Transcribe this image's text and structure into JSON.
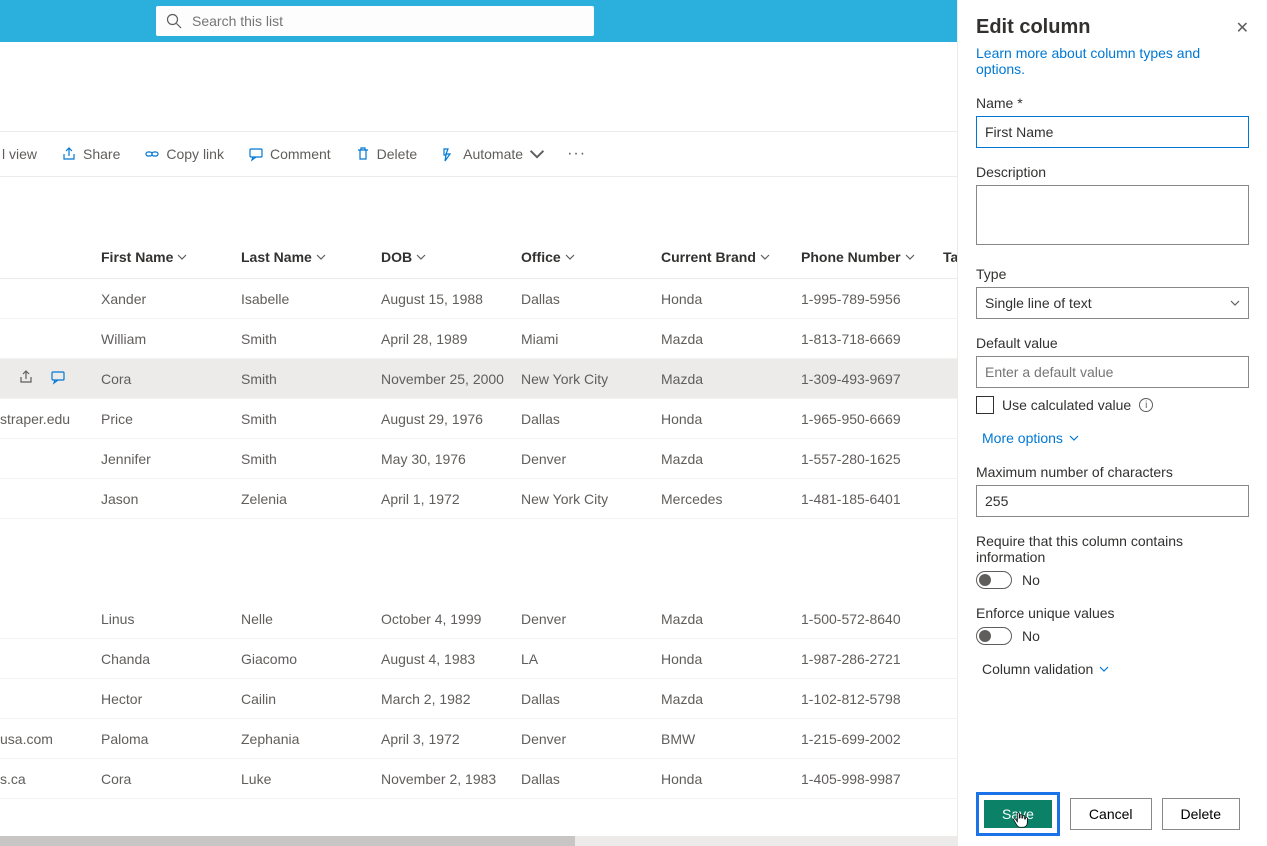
{
  "search": {
    "placeholder": "Search this list"
  },
  "commands": {
    "gridview": "l view",
    "share": "Share",
    "copylink": "Copy link",
    "comment": "Comment",
    "delete": "Delete",
    "automate": "Automate"
  },
  "columns": {
    "firstname": "First Name",
    "lastname": "Last Name",
    "dob": "DOB",
    "office": "Office",
    "brand": "Current Brand",
    "phone": "Phone Number",
    "extra": "Ta"
  },
  "rows": [
    {
      "email": "",
      "first": "Xander",
      "last": "Isabelle",
      "dob": "August 15, 1988",
      "office": "Dallas",
      "brand": "Honda",
      "phone": "1-995-789-5956"
    },
    {
      "email": "",
      "first": "William",
      "last": "Smith",
      "dob": "April 28, 1989",
      "office": "Miami",
      "brand": "Mazda",
      "phone": "1-813-718-6669"
    },
    {
      "email": "",
      "first": "Cora",
      "last": "Smith",
      "dob": "November 25, 2000",
      "office": "New York City",
      "brand": "Mazda",
      "phone": "1-309-493-9697",
      "selected": true,
      "icons": true
    },
    {
      "email": "straper.edu",
      "first": "Price",
      "last": "Smith",
      "dob": "August 29, 1976",
      "office": "Dallas",
      "brand": "Honda",
      "phone": "1-965-950-6669"
    },
    {
      "email": "",
      "first": "Jennifer",
      "last": "Smith",
      "dob": "May 30, 1976",
      "office": "Denver",
      "brand": "Mazda",
      "phone": "1-557-280-1625"
    },
    {
      "email": "",
      "first": "Jason",
      "last": "Zelenia",
      "dob": "April 1, 1972",
      "office": "New York City",
      "brand": "Mercedes",
      "phone": "1-481-185-6401"
    }
  ],
  "rows2": [
    {
      "email": "",
      "first": "Linus",
      "last": "Nelle",
      "dob": "October 4, 1999",
      "office": "Denver",
      "brand": "Mazda",
      "phone": "1-500-572-8640"
    },
    {
      "email": "",
      "first": "Chanda",
      "last": "Giacomo",
      "dob": "August 4, 1983",
      "office": "LA",
      "brand": "Honda",
      "phone": "1-987-286-2721"
    },
    {
      "email": "",
      "first": "Hector",
      "last": "Cailin",
      "dob": "March 2, 1982",
      "office": "Dallas",
      "brand": "Mazda",
      "phone": "1-102-812-5798"
    },
    {
      "email": "usa.com",
      "first": "Paloma",
      "last": "Zephania",
      "dob": "April 3, 1972",
      "office": "Denver",
      "brand": "BMW",
      "phone": "1-215-699-2002"
    },
    {
      "email": "s.ca",
      "first": "Cora",
      "last": "Luke",
      "dob": "November 2, 1983",
      "office": "Dallas",
      "brand": "Honda",
      "phone": "1-405-998-9987"
    }
  ],
  "panel": {
    "title": "Edit column",
    "learn": "Learn more about column types and options.",
    "name_label": "Name *",
    "name_value": "First Name",
    "description_label": "Description",
    "type_label": "Type",
    "type_value": "Single line of text",
    "default_label": "Default value",
    "default_placeholder": "Enter a default value",
    "calc_label": "Use calculated value",
    "more_options": "More options",
    "max_label": "Maximum number of characters",
    "max_value": "255",
    "require_label": "Require that this column contains information",
    "toggle_no": "No",
    "unique_label": "Enforce unique values",
    "validation": "Column validation",
    "save": "Save",
    "cancel": "Cancel",
    "delete": "Delete"
  }
}
